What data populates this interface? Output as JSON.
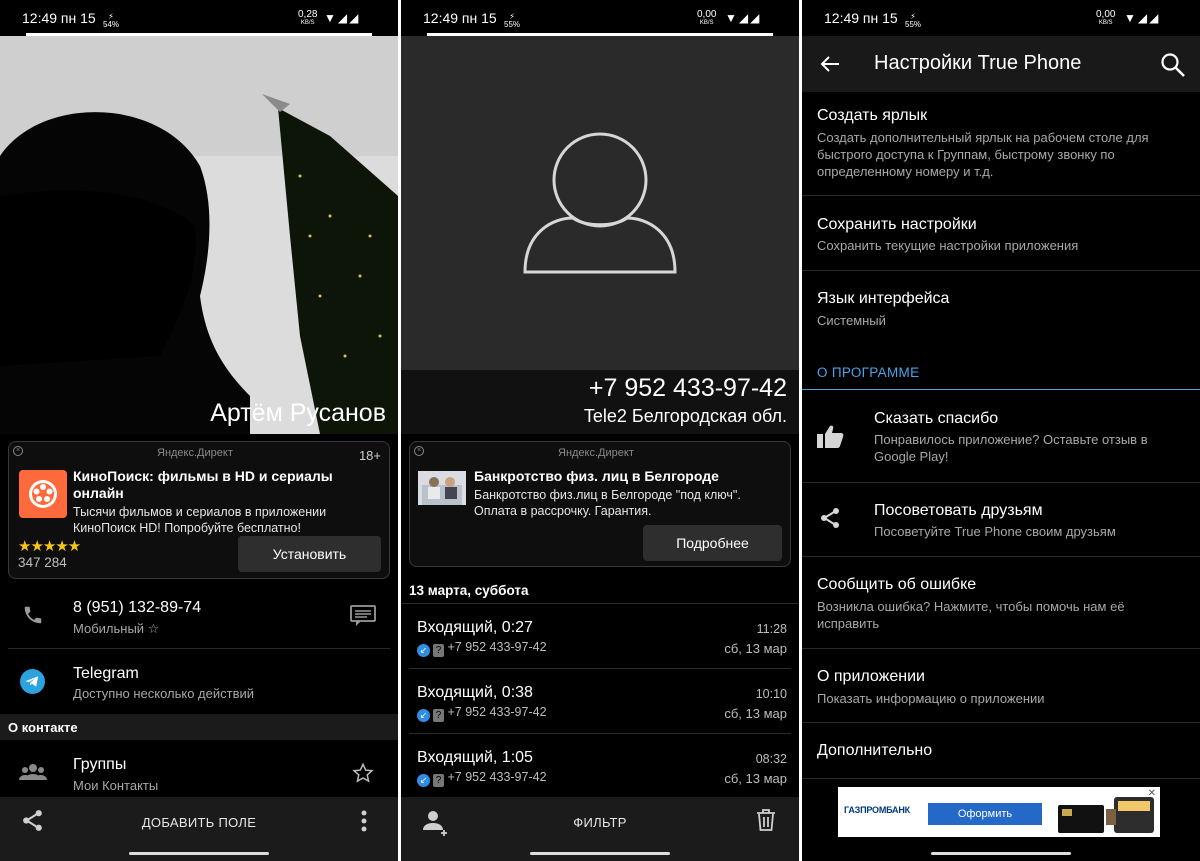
{
  "status": [
    {
      "time": "12:49 пн 15",
      "battery": "54%",
      "net_value": "0,28",
      "net_unit": "KB/S"
    },
    {
      "time": "12:49 пн 15",
      "battery": "55%",
      "net_value": "0,00",
      "net_unit": "KB/S"
    },
    {
      "time": "12:49 пн 15",
      "battery": "55%",
      "net_value": "0,00",
      "net_unit": "KB/S"
    }
  ],
  "contact": {
    "name": "Артём Русанов",
    "ad": {
      "source": "Яндекс.Директ",
      "age": "18+",
      "title": "КиноПоиск: фильмы в HD и сериалы онлайн",
      "text": "Тысячи фильмов и сериалов в приложении КиноПоиск HD! Попробуйте бесплатно!",
      "rating": 4.5,
      "rating_stars": "★★★★★",
      "reviews": "347 284",
      "button": "Установить"
    },
    "phone": {
      "number": "8 (951) 132-89-74",
      "label": "Мобильный ☆"
    },
    "telegram": {
      "title": "Telegram",
      "sub": "Доступно несколько действий"
    },
    "section_about": "О контакте",
    "groups": {
      "title": "Группы",
      "sub": "Мои Контакты"
    },
    "bottom": {
      "add_field": "ДОБАВИТЬ ПОЛЕ"
    }
  },
  "calls": {
    "number": "+7 952 433-97-42",
    "region": "Tele2 Белгородская обл.",
    "ad": {
      "source": "Яндекс.Директ",
      "title": "Банкротство физ. лиц в Белгороде",
      "text": "Банкротство физ.лиц в Белгороде \"под ключ\". Оплата в рассрочку. Гарантия.",
      "button": "Подробнее"
    },
    "date_header": "13 марта, суббота",
    "entries": [
      {
        "title": "Входящий, 0:27",
        "number": "+7 952 433-97-42",
        "time": "11:28",
        "date": "сб, 13 мар"
      },
      {
        "title": "Входящий, 0:38",
        "number": "+7 952 433-97-42",
        "time": "10:10",
        "date": "сб, 13 мар"
      },
      {
        "title": "Входящий, 1:05",
        "number": "+7 952 433-97-42",
        "time": "08:32",
        "date": "сб, 13 мар"
      }
    ],
    "bottom": {
      "filter": "ФИЛЬТР"
    }
  },
  "settings": {
    "title": "Настройки True Phone",
    "items": [
      {
        "title": "Создать ярлык",
        "sub": "Создать дополнительный ярлык на рабочем столе для быстрого доступа к Группам, быстрому звонку по определенному номеру и т.д."
      },
      {
        "title": "Сохранить настройки",
        "sub": "Сохранить текущие настройки приложения"
      },
      {
        "title": "Язык интерфейса",
        "sub": "Системный"
      }
    ],
    "section_about": "О ПРОГРАММЕ",
    "about_items": [
      {
        "title": "Сказать спасибо",
        "sub": "Понравилось приложение? Оставьте отзыв в Google Play!"
      },
      {
        "title": "Посоветовать друзьям",
        "sub": "Посоветуйте True Phone своим друзьям"
      },
      {
        "title": "Сообщить об ошибке",
        "sub": "Возникла ошибка? Нажмите, чтобы помочь нам её исправить"
      },
      {
        "title": "О приложении",
        "sub": "Показать информацию о приложении"
      },
      {
        "title": "Дополнительно",
        "sub": ""
      }
    ],
    "banner": {
      "brand": "ГАЗПРОМБАНК",
      "button": "Оформить"
    }
  },
  "colors": {
    "accent": "#4aa3e8",
    "star": "#f5c518",
    "ad_orange": "#ff6a3d"
  }
}
